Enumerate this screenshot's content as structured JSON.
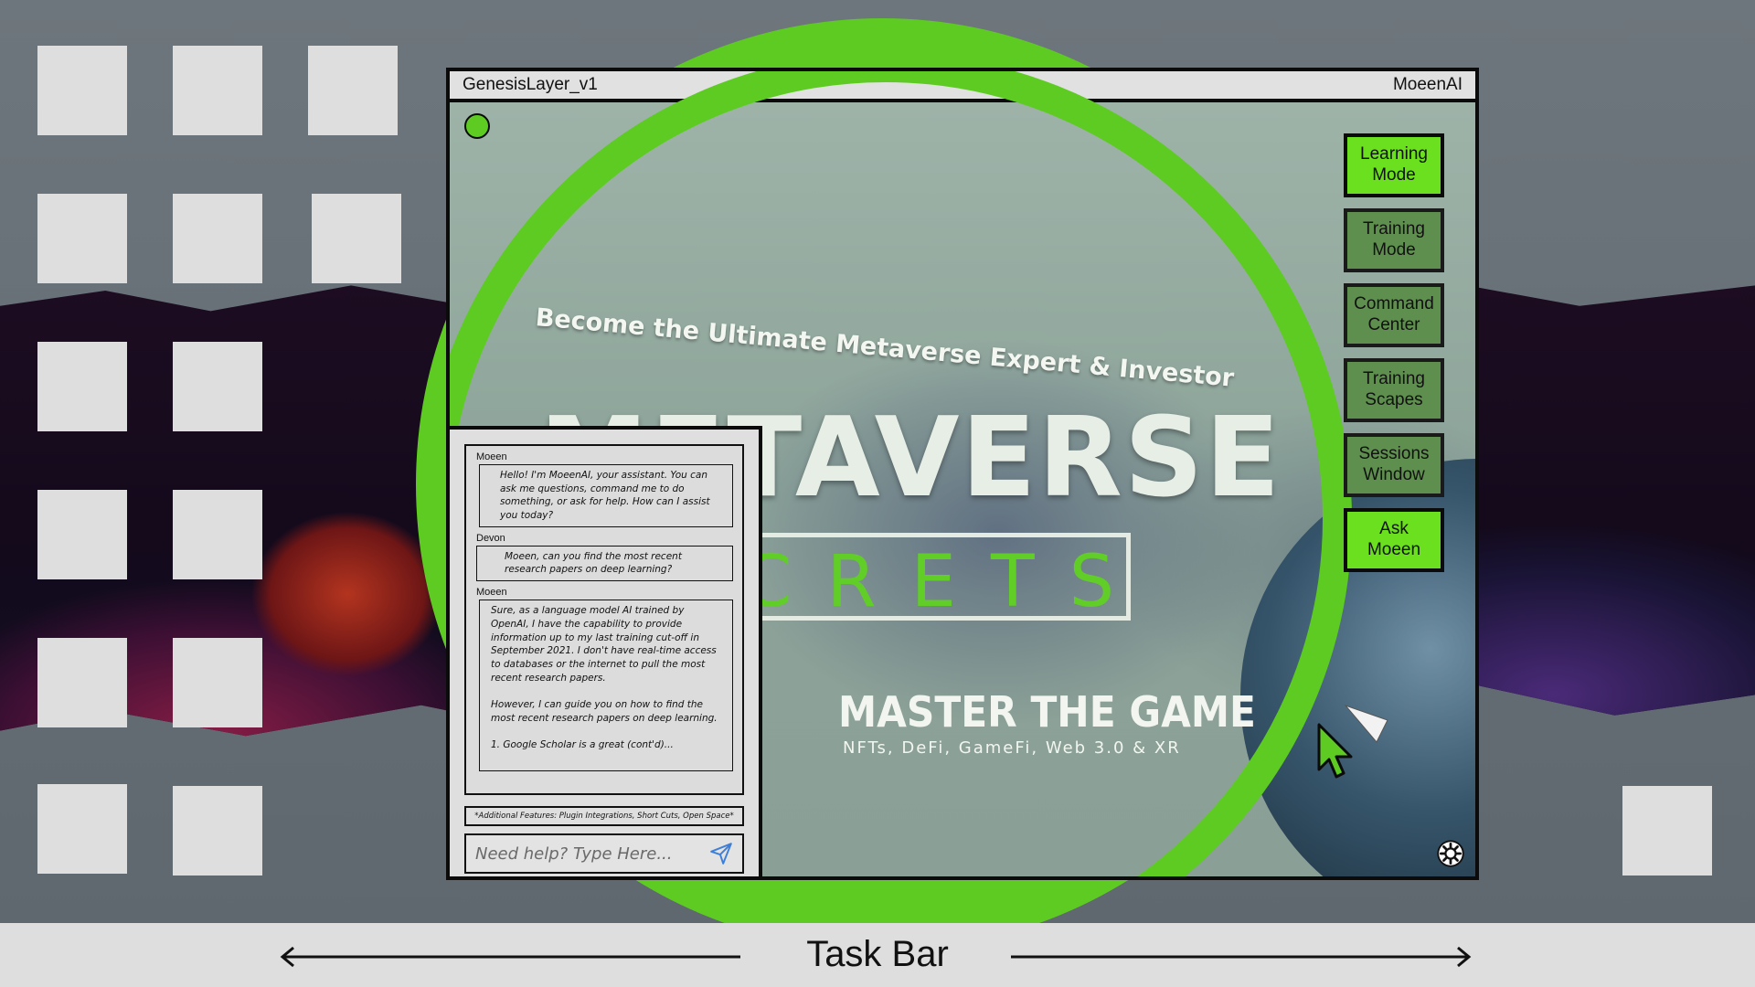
{
  "window": {
    "title": "GenesisLayer_v1",
    "app_name": "MoeenAI"
  },
  "banner": {
    "headline": "Become the Ultimate Metaverse Expert & Investor",
    "title": "METAVERSE",
    "subtitle": "CRETS",
    "tagline": "MASTER THE GAME",
    "tagline_sub": "NFTs, DeFi, GameFi, Web 3.0 & XR"
  },
  "modes": [
    {
      "label": "Learning\nMode",
      "active": true
    },
    {
      "label": "Training\nMode",
      "active": false
    },
    {
      "label": "Command\nCenter",
      "active": false
    },
    {
      "label": "Training\nScapes",
      "active": false
    },
    {
      "label": "Sessions\nWindow",
      "active": false
    },
    {
      "label": "Ask\nMoeen",
      "active": true
    }
  ],
  "chat": {
    "messages": [
      {
        "speaker": "Moeen",
        "text": "Hello! I'm MoeenAI, your assistant. You can ask me questions, command me to do something, or ask for help. How can I assist you today?"
      },
      {
        "speaker": "Devon",
        "text": "Moeen, can you find the most recent research papers on deep learning?"
      },
      {
        "speaker": "Moeen",
        "text": "Sure, as a language model AI trained by OpenAI, I have the capability to provide information up to my last training cut-off in September 2021. I don't have real-time access to databases or the internet to pull the most recent research papers.\n\nHowever, I can guide you on how to find the most recent research papers on deep learning.\n\n1. Google Scholar is a great (cont'd)..."
      }
    ],
    "features_note": "*Additional Features: Plugin Integrations, Short Cuts, Open Space*",
    "input_placeholder": "Need help? Type Here..."
  },
  "taskbar": {
    "label": "Task Bar"
  },
  "colors": {
    "accent_green": "#5ecb23",
    "button_active": "#6be01f",
    "button_inactive": "#5f8f4e",
    "titlebar": "#e1e1e1",
    "taskbar": "#dedede"
  },
  "icons": [
    "status-dot-icon",
    "send-icon",
    "gear-icon",
    "cursor-icon",
    "arrow-left-icon",
    "arrow-right-icon"
  ]
}
